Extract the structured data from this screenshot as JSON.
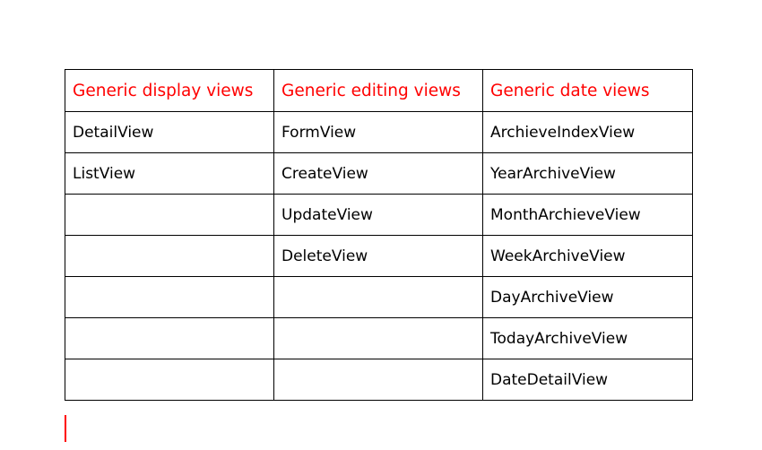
{
  "document": {
    "table": {
      "headers": [
        "Generic display views",
        "Generic editing views",
        "Generic date views"
      ],
      "rows": [
        [
          "DetailView",
          "FormView",
          "ArchieveIndexView"
        ],
        [
          "ListView",
          "CreateView",
          "YearArchiveView"
        ],
        [
          "",
          "UpdateView",
          "MonthArchieveView"
        ],
        [
          "",
          "DeleteView",
          "WeekArchiveView"
        ],
        [
          "",
          "",
          "DayArchiveView"
        ],
        [
          "",
          "",
          "TodayArchiveView"
        ],
        [
          "",
          "",
          "DateDetailView"
        ]
      ]
    },
    "colors": {
      "header_text": "#ff0000",
      "body_text": "#000000",
      "border": "#000000",
      "cursor": "#ff0000"
    }
  }
}
